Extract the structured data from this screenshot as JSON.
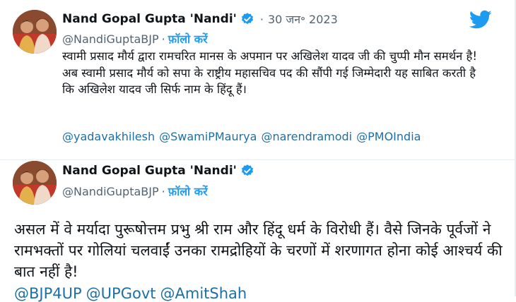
{
  "tweet1": {
    "name": "Nand Gopal Gupta 'Nandi'",
    "date": "30 जन॰ 2023",
    "handle": "@NandiGuptaBJP",
    "follow_label": "फ़ॉलो करें",
    "text": "स्वामी प्रसाद मौर्य द्वारा रामचरित मानस के अपमान पर अखिलेश यादव जी की चुप्पी मौन समर्थन है! अब स्वामी प्रसाद मौर्य को सपा के राष्ट्रीय महासचिव पद की सौंपी गई जिम्मेदारी यह साबित करती है कि अखिलेश यादव जी सिर्फ नाम के हिंदू हैं।",
    "mentions": [
      "@yadavakhilesh",
      "@SwamiPMaurya",
      "@narendramodi",
      "@PMOIndia"
    ]
  },
  "tweet2": {
    "name": "Nand Gopal Gupta 'Nandi'",
    "handle": "@NandiGuptaBJP",
    "follow_label": "फ़ॉलो करें",
    "text": "असल में वे मर्यादा पुरूषोत्तम प्रभु श्री राम और हिंदू धर्म के विरोधी हैं। वैसे जिनके पूर्वजों ने रामभक्तों पर गोलियां चलवाईं उनका रामद्रोहियों के चरणों में शरणागत होना कोई आश्चर्य की बात नहीं है!",
    "mentions": [
      "@BJP4UP",
      "@UPGovt",
      "@AmitShah"
    ]
  },
  "colors": {
    "link": "#1d9bf0",
    "mention": "#1d6fa5",
    "muted": "#536471"
  },
  "icons": {
    "verified": "verified-badge-icon",
    "twitter": "twitter-bird-icon"
  }
}
